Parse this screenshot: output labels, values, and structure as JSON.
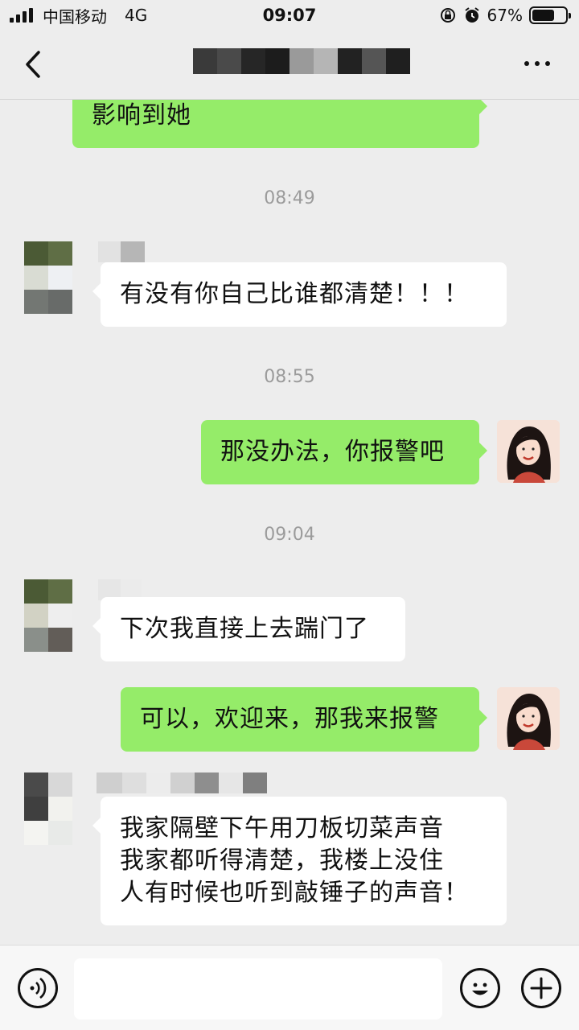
{
  "status": {
    "carrier": "中国移动",
    "network": "4G",
    "time": "09:07",
    "battery_pct": "67%",
    "battery_level": 0.67
  },
  "chat": {
    "messages": [
      {
        "side": "right",
        "text": "影响到她"
      },
      {
        "type": "time",
        "text": "08:49"
      },
      {
        "side": "left",
        "text": "有没有你自己比谁都清楚！！！"
      },
      {
        "type": "time",
        "text": "08:55"
      },
      {
        "side": "right",
        "text": "那没办法，你报警吧"
      },
      {
        "type": "time",
        "text": "09:04"
      },
      {
        "side": "left",
        "text": "下次我直接上去踹门了"
      },
      {
        "side": "right",
        "text": "可以，欢迎来，那我来报警"
      },
      {
        "side": "left",
        "lines": [
          "我家隔壁下午用刀板切菜声音",
          "我家都听得清楚，我楼上没住",
          "人有时候也听到敲锤子的声音！"
        ]
      }
    ]
  },
  "colors": {
    "background": "#ededed",
    "bubble_self": "#95ec69",
    "bubble_other": "#ffffff",
    "timestamp": "#9b9b9b"
  },
  "icons": {
    "back": "chevron-left-icon",
    "more": "more-dots-icon",
    "voice": "voice-icon",
    "emoji": "emoji-icon",
    "add": "plus-icon"
  }
}
